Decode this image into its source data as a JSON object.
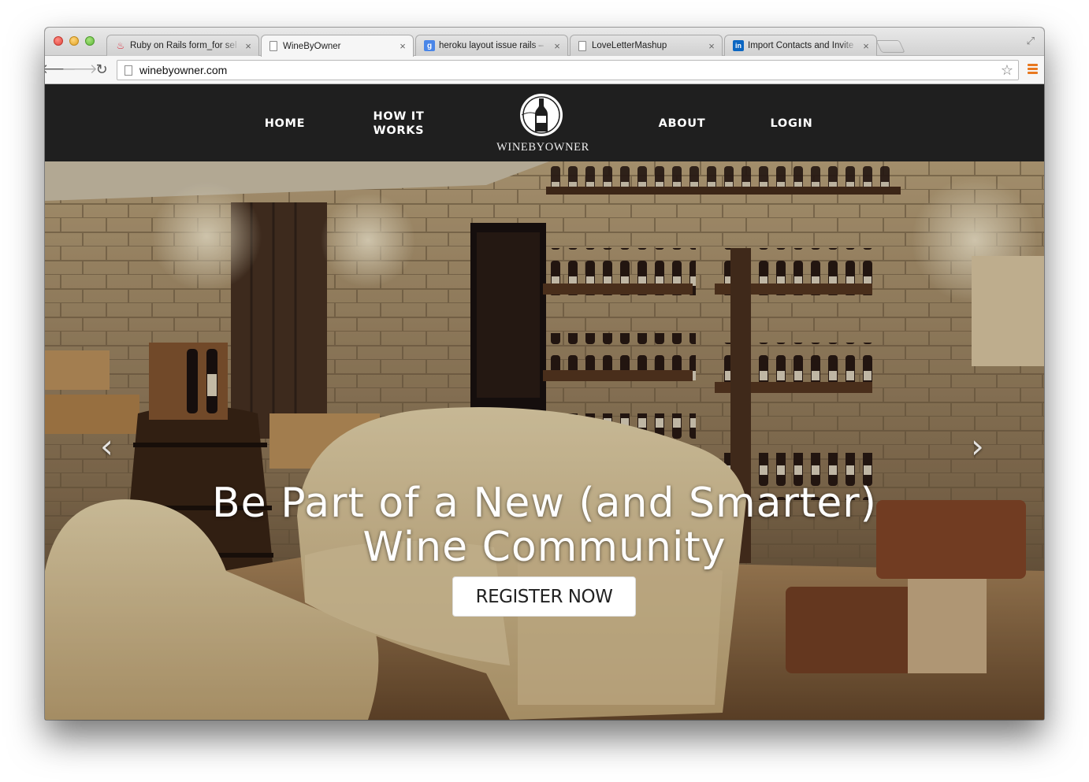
{
  "browser": {
    "tabs": [
      {
        "title": "Ruby on Rails form_for sel",
        "favicon": "rails-icon",
        "active": false
      },
      {
        "title": "WineByOwner",
        "favicon": "page-icon",
        "active": true
      },
      {
        "title": "heroku layout issue rails –",
        "favicon": "google-icon",
        "active": false
      },
      {
        "title": "LoveLetterMashup",
        "favicon": "page-icon",
        "active": false
      },
      {
        "title": "Import Contacts and Invite",
        "favicon": "linkedin-icon",
        "active": false
      }
    ],
    "close_glyph": "×",
    "url": "winebyowner.com"
  },
  "site": {
    "nav": {
      "home": "HOME",
      "how_it_works_line1": "HOW IT",
      "how_it_works_line2": "WORKS",
      "about": "ABOUT",
      "login": "LOGIN"
    },
    "logo_text": "WINEBYOWNER"
  },
  "hero": {
    "headline_line1": "Be Part of a New (and Smarter)",
    "headline_line2": "Wine Community",
    "cta": "REGISTER NOW",
    "prev_glyph": "‹",
    "next_glyph": "›"
  },
  "colors": {
    "header_bg": "#1f1f1f",
    "menu_accent": "#e8781f"
  }
}
